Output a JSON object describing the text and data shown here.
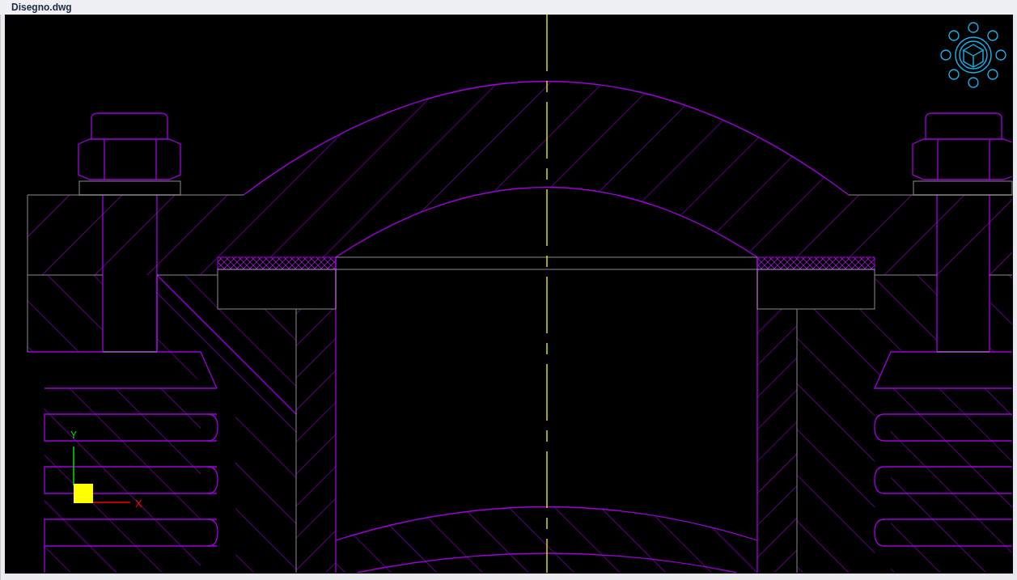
{
  "window": {
    "title": "Disegno.dwg"
  },
  "ucs_icon": {
    "x_label": "X",
    "y_label": "Y"
  }
}
